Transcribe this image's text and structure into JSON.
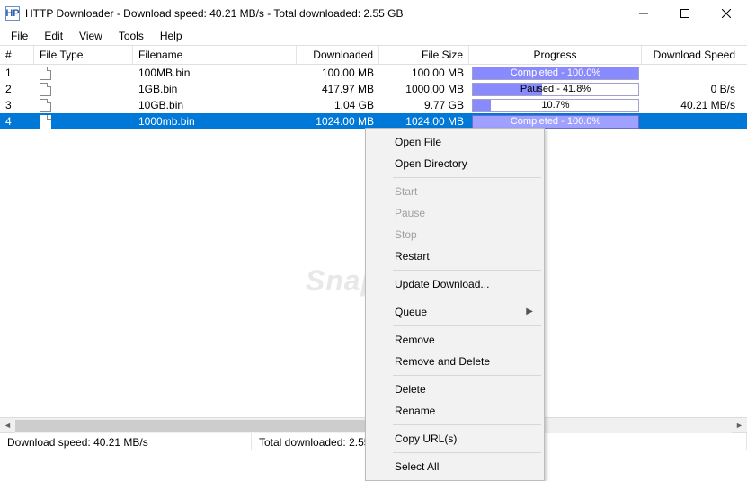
{
  "window": {
    "app_abbrev": "HP",
    "title": "HTTP Downloader - Download speed:  40.21 MB/s - Total downloaded:  2.55 GB"
  },
  "menu": {
    "file": "File",
    "edit": "Edit",
    "view": "View",
    "tools": "Tools",
    "help": "Help"
  },
  "columns": {
    "num": "#",
    "filetype": "File Type",
    "filename": "Filename",
    "downloaded": "Downloaded",
    "filesize": "File Size",
    "progress": "Progress",
    "speed": "Download Speed"
  },
  "rows": [
    {
      "num": "1",
      "filename": "100MB.bin",
      "downloaded": "100.00 MB",
      "filesize": "100.00 MB",
      "progress_label": "Completed - 100.0%",
      "progress_percent": 100,
      "status": "completed",
      "speed": ""
    },
    {
      "num": "2",
      "filename": "1GB.bin",
      "downloaded": "417.97 MB",
      "filesize": "1000.00 MB",
      "progress_label": "Paused - 41.8%",
      "progress_percent": 41.8,
      "status": "paused",
      "speed": "0 B/s"
    },
    {
      "num": "3",
      "filename": "10GB.bin",
      "downloaded": "1.04 GB",
      "filesize": "9.77 GB",
      "progress_label": "10.7%",
      "progress_percent": 10.7,
      "status": "downloading",
      "speed": "40.21 MB/s"
    },
    {
      "num": "4",
      "filename": "1000mb.bin",
      "downloaded": "1024.00 MB",
      "filesize": "1024.00 MB",
      "progress_label": "Completed - 100.0%",
      "progress_percent": 100,
      "status": "completed",
      "speed": "",
      "selected": true
    }
  ],
  "statusbar": {
    "speed": "Download speed:  40.21 MB/s",
    "total": "Total downloaded:  2.55 GB"
  },
  "context_menu": {
    "open_file": "Open File",
    "open_directory": "Open Directory",
    "start": "Start",
    "pause": "Pause",
    "stop": "Stop",
    "restart": "Restart",
    "update_download": "Update Download...",
    "queue": "Queue",
    "remove": "Remove",
    "remove_and_delete": "Remove and Delete",
    "delete": "Delete",
    "rename": "Rename",
    "copy_urls": "Copy URL(s)",
    "select_all": "Select All"
  },
  "watermark": "Snapfiles"
}
